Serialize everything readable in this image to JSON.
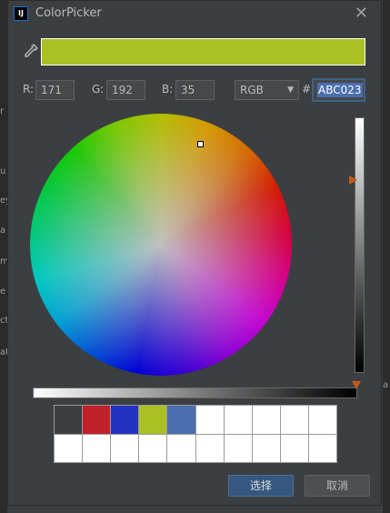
{
  "window": {
    "title": "ColorPicker",
    "icon_text": "IJ"
  },
  "background_fragments": {
    "left": [
      "r",
      "u",
      "ey",
      "a",
      "m",
      "e",
      "ct",
      "at"
    ],
    "right": [
      "a"
    ]
  },
  "preview": {
    "color": "#abc023"
  },
  "rgb": {
    "r_label": "R:",
    "r_value": "171",
    "g_label": "G:",
    "g_value": "192",
    "b_label": "B:",
    "b_value": "35"
  },
  "mode": {
    "selected": "RGB"
  },
  "hex": {
    "prefix": "#",
    "value": "ABC023"
  },
  "color_wheel": {
    "brightness_slider_value": 1.0,
    "opacity_slider_value": 1.0
  },
  "recent_colors": [
    "#3c3f41",
    "#c0202a",
    "#2233c0",
    "#abc023",
    "#4b6eaf",
    "#ffffff",
    "#ffffff",
    "#ffffff",
    "#ffffff",
    "#ffffff",
    "#ffffff",
    "#ffffff",
    "#ffffff",
    "#ffffff",
    "#ffffff",
    "#ffffff",
    "#ffffff",
    "#ffffff",
    "#ffffff",
    "#ffffff"
  ],
  "buttons": {
    "ok_label": "选择",
    "cancel_label": "取消"
  }
}
